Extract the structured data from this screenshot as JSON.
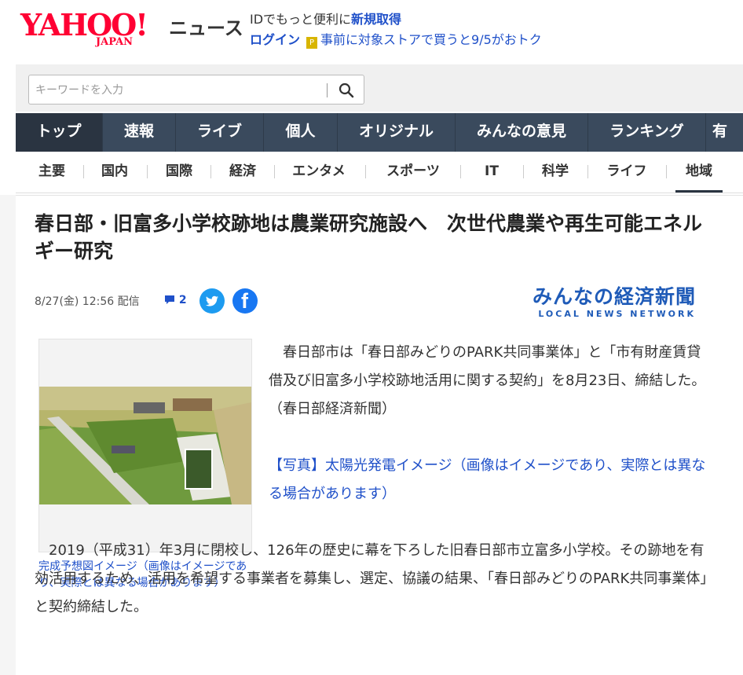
{
  "header": {
    "logo_main": "YAHOO!",
    "logo_sub": "JAPAN",
    "service": "ニュース",
    "promo_line1_text": "IDでもっと便利に",
    "promo_line1_link": "新規取得",
    "promo_login": "ログイン",
    "promo_store": "事前に対象ストアで買うと9/5がおトク",
    "tpoint_badge": "P"
  },
  "search": {
    "placeholder": "キーワードを入力",
    "value": ""
  },
  "global_nav": [
    "トップ",
    "速報",
    "ライブ",
    "個人",
    "オリジナル",
    "みんなの意見",
    "ランキング",
    "有"
  ],
  "category_nav": [
    "主要",
    "国内",
    "国際",
    "経済",
    "エンタメ",
    "スポーツ",
    "IT",
    "科学",
    "ライフ",
    "地域"
  ],
  "article": {
    "title": "春日部・旧富多小学校跡地は農業研究施設へ　次世代農業や再生可能エネルギー研究",
    "date": "8/27(金) 12:56 配信",
    "comment_count": "2",
    "source_name": "みんなの経済新聞",
    "source_sub": "LOCAL NEWS NETWORK",
    "photo_caption": "完成予想図イメージ（画像はイメージであり、実際とは異なる場合があります）",
    "para1": "　春日部市は「春日部みどりのPARK共同事業体」と「市有財産賃貸借及び旧富多小学校跡地活用に関する契約」を8月23日、締結した。（春日部経済新聞）",
    "photo_link": "【写真】太陽光発電イメージ（画像はイメージであり、実際とは異なる場合があります）",
    "para2": "　2019（平成31）年3月に閉校し、126年の歴史に幕を下ろした旧春日部市立富多小学校。その跡地を有効活用するため、活用を希望する事業者を募集し、選定、協議の結果、「春日部みどりのPARK共同事業体」と契約締結した。"
  },
  "colors": {
    "brand": "#ff0033",
    "link": "#1f50c9",
    "nav_bg": "#3a4a5d"
  }
}
